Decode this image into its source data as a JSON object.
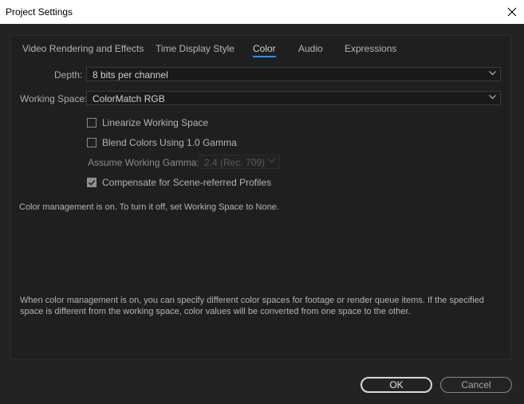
{
  "window": {
    "title": "Project Settings"
  },
  "tabs": [
    {
      "label": "Video Rendering and Effects"
    },
    {
      "label": "Time Display Style"
    },
    {
      "label": "Color"
    },
    {
      "label": "Audio"
    },
    {
      "label": "Expressions"
    }
  ],
  "active_tab": "Color",
  "depth": {
    "label": "Depth:",
    "value": "8 bits per channel"
  },
  "working_space": {
    "label": "Working Space:",
    "value": "ColorMatch RGB"
  },
  "options": {
    "linearize": {
      "label": "Linearize Working Space",
      "checked": false
    },
    "blend": {
      "label": "Blend Colors Using 1.0 Gamma",
      "checked": false
    },
    "gamma": {
      "label": "Assume Working Gamma:",
      "value": "2.4 (Rec. 709)"
    },
    "compensate": {
      "label": "Compensate for Scene-referred Profiles",
      "checked": true
    }
  },
  "status_text": "Color management is on. To turn it off, set Working Space to None.",
  "info_text": "When color management is on, you can specify different color spaces for footage or render queue items. If the specified space is different from the working space, color values will be converted from one space to the other.",
  "buttons": {
    "ok": "OK",
    "cancel": "Cancel"
  },
  "colors": {
    "accent": "#2d8ceb",
    "background": "#232323",
    "panel": "#1f1f1f"
  },
  "icons": {
    "close": "close-icon",
    "dropdown": "chevron-down-icon",
    "check": "check-icon"
  }
}
